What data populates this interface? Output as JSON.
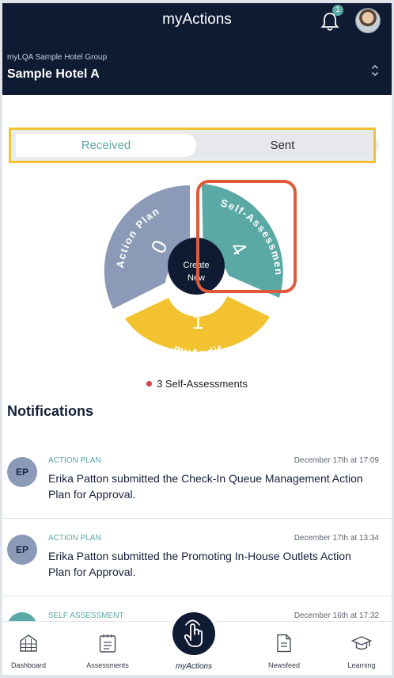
{
  "header": {
    "title": "myActions",
    "notification_count": "1"
  },
  "hotel": {
    "group": "myLQA Sample Hotel Group",
    "name": "Sample Hotel A"
  },
  "segments": {
    "received": "Received",
    "sent": "Sent",
    "selected": "received"
  },
  "wheel": {
    "action_plan": {
      "label": "Action Plan",
      "count": "0",
      "color": "#8b9ab7"
    },
    "self_assessment": {
      "label": "Self-Assessment",
      "count": "4",
      "color": "#5aa9a5"
    },
    "my_audit": {
      "label": "myAudit",
      "count": "1",
      "color": "#f2c230"
    },
    "center_line1": "Create",
    "center_line2": "New"
  },
  "legend": {
    "text": "3 Self-Assessments",
    "dot_color": "#e03a4a"
  },
  "notifications": {
    "title": "Notifications",
    "items": [
      {
        "initials": "EP",
        "category": "ACTION PLAN",
        "time": "December 17th at 17:09",
        "message": "Erika Patton submitted the Check-In Queue Management Action Plan for Approval."
      },
      {
        "initials": "EP",
        "category": "ACTION PLAN",
        "time": "December 17th at 13:34",
        "message": "Erika Patton submitted the Promoting In-House Outlets Action Plan for Approval."
      },
      {
        "initials": "",
        "category": "SELF ASSESSMENT",
        "time": "December 16th at 17:32",
        "message": ""
      }
    ]
  },
  "nav": {
    "dashboard": "Dashboard",
    "assessments": "Assessments",
    "myactions": "myActions",
    "newsfeed": "Newsfeed",
    "learning": "Learning"
  },
  "colors": {
    "navy": "#0f1a33",
    "teal": "#5aa9a5",
    "yellow": "#f2c230",
    "highlight_red": "#e05a3a"
  }
}
